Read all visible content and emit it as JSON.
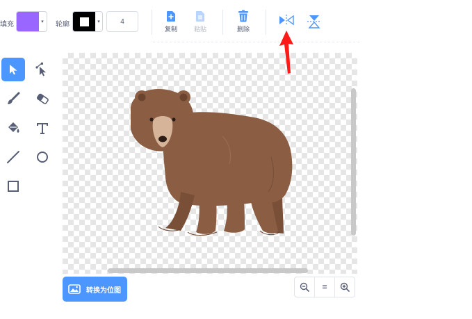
{
  "toolbar": {
    "fill_label": "填充",
    "fill_color": "#9966ff",
    "outline_label": "轮廓",
    "outline_color": "#000000",
    "outline_width": "4",
    "copy_label": "复制",
    "paste_label": "粘贴",
    "delete_label": "删除",
    "flip_horizontal_icon": "flip-horizontal-icon",
    "flip_vertical_icon": "flip-vertical-icon"
  },
  "tools": [
    {
      "name": "select",
      "icon": "select-arrow-icon",
      "active": true
    },
    {
      "name": "reshape",
      "icon": "reshape-icon",
      "active": false
    },
    {
      "name": "brush",
      "icon": "brush-icon",
      "active": false
    },
    {
      "name": "eraser",
      "icon": "eraser-icon",
      "active": false
    },
    {
      "name": "fill",
      "icon": "paint-bucket-icon",
      "active": false
    },
    {
      "name": "text",
      "icon": "text-icon",
      "active": false
    },
    {
      "name": "line",
      "icon": "line-icon",
      "active": false
    },
    {
      "name": "circle",
      "icon": "circle-icon",
      "active": false
    },
    {
      "name": "rectangle",
      "icon": "rectangle-icon",
      "active": false
    }
  ],
  "canvas": {
    "costume": "bear-costume"
  },
  "bottom": {
    "convert_label": "转换为位图"
  },
  "colors": {
    "accent": "#4c97ff",
    "annotation_arrow": "#ff1a1a",
    "bear_body": "#8b5e44"
  }
}
